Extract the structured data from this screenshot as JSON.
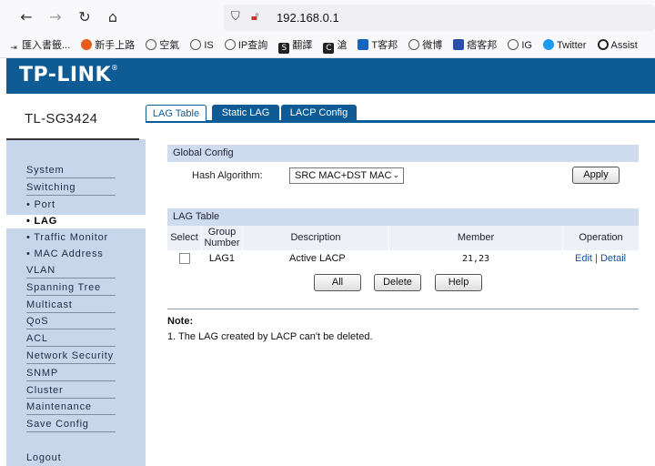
{
  "browser": {
    "url": "192.168.0.1",
    "bookmarks": [
      "匯入書籤...",
      "新手上路",
      "空氣",
      "IS",
      "IP查詢",
      "翻譯",
      "滄",
      "T客邦",
      "微博",
      "痞客邦",
      "IG",
      "Twitter",
      "Assist"
    ]
  },
  "header": {
    "logo": "TP-LINK",
    "logo_mark": "®"
  },
  "sidebar": {
    "model": "TL-SG3424",
    "items": [
      "System",
      "Switching",
      "• Port",
      "• LAG",
      "• Traffic Monitor",
      "• MAC Address",
      "VLAN",
      "Spanning Tree",
      "Multicast",
      "QoS",
      "ACL",
      "Network Security",
      "SNMP",
      "Cluster",
      "Maintenance",
      "Save Config",
      "Logout"
    ]
  },
  "tabs": [
    "LAG Table",
    "Static LAG",
    "LACP Config"
  ],
  "global_config": {
    "title": "Global Config",
    "hash_label": "Hash Algorithm:",
    "hash_value": "SRC MAC+DST MAC",
    "apply": "Apply"
  },
  "lag_table": {
    "title": "LAG Table",
    "headers": {
      "select": "Select",
      "group_number": "Group Number",
      "description": "Description",
      "member": "Member",
      "operation": "Operation"
    },
    "rows": [
      {
        "group": "LAG1",
        "description": "Active LACP",
        "member": "21,23",
        "edit": "Edit",
        "detail": "Detail"
      }
    ],
    "buttons": {
      "all": "All",
      "delete": "Delete",
      "help": "Help"
    }
  },
  "note": {
    "title": "Note:",
    "text": "1. The LAG created by LACP can't be deleted."
  },
  "colors": {
    "brand": "#0e5b95",
    "sidebar": "#c8d6ec",
    "section_header": "#cfdcf0"
  }
}
